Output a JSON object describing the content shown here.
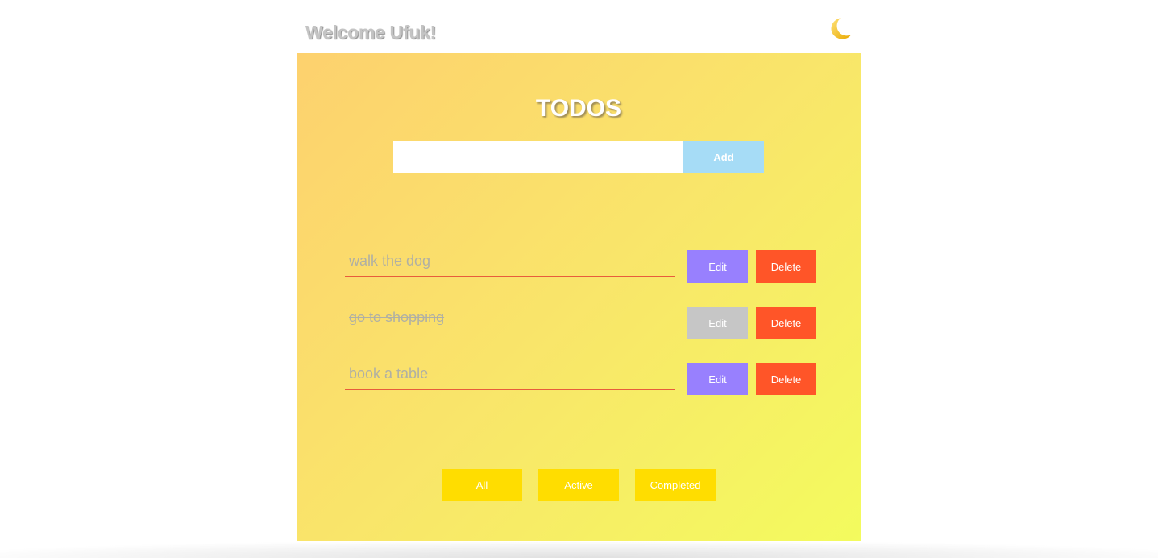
{
  "header": {
    "welcome_text": "Welcome Ufuk!",
    "theme_icon": "moon-icon"
  },
  "title": "TODOS",
  "add_form": {
    "input_value": "",
    "placeholder": "",
    "add_label": "Add"
  },
  "todos": [
    {
      "text": "walk the dog",
      "completed": false,
      "edit_label": "Edit",
      "delete_label": "Delete"
    },
    {
      "text": "go to shopping",
      "completed": true,
      "edit_label": "Edit",
      "delete_label": "Delete"
    },
    {
      "text": "book a table",
      "completed": false,
      "edit_label": "Edit",
      "delete_label": "Delete"
    }
  ],
  "filters": [
    {
      "label": "All"
    },
    {
      "label": "Active"
    },
    {
      "label": "Completed"
    }
  ],
  "colors": {
    "gradient_start": "#fdd16e",
    "gradient_end": "#f3fb5e",
    "add_button": "#a6dcf6",
    "edit_button": "#9880fe",
    "edit_button_disabled": "#c6c6c6",
    "delete_button": "#ff5528",
    "filter_button": "#ffdd00",
    "todo_underline": "#e85c3c"
  }
}
